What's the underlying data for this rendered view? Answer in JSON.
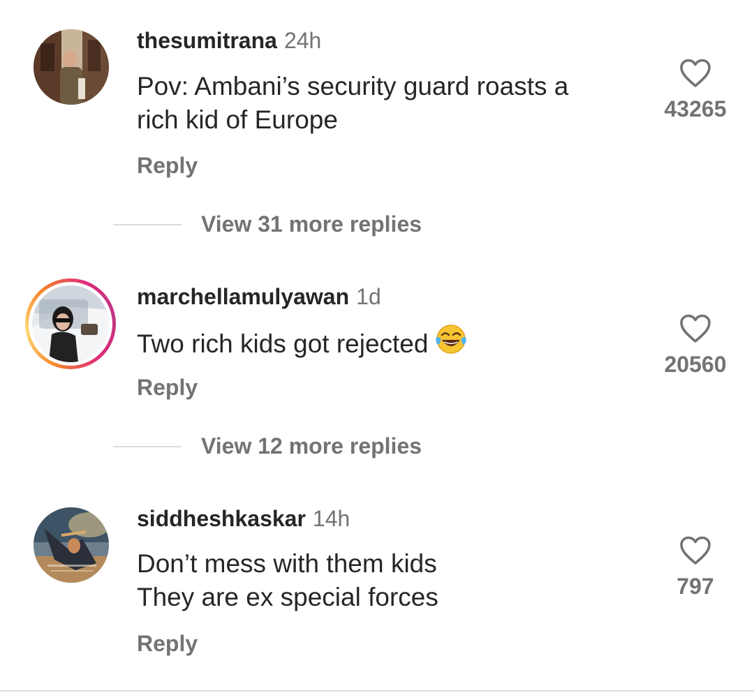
{
  "comments": [
    {
      "username": "thesumitrana",
      "time": "24h",
      "lines": [
        "Pov: Ambani’s security guard roasts a",
        "rich kid of Europe"
      ],
      "reply_label": "Reply",
      "likes": "43265",
      "view_replies": "View 31 more replies",
      "avatar_icon": "avatar-photo-man-walking"
    },
    {
      "username": "marchellamulyawan",
      "time": "1d",
      "lines": [
        "Two rich kids got rejected"
      ],
      "emoji": "tears-of-joy-emoji",
      "reply_label": "Reply",
      "likes": "20560",
      "view_replies": "View 12 more replies",
      "avatar_icon": "avatar-photo-woman-in-car",
      "has_story": true
    },
    {
      "username": "siddheshkaskar",
      "time": "14h",
      "lines": [
        "Don’t mess with them kids",
        "They are ex special forces"
      ],
      "reply_label": "Reply",
      "likes": "797",
      "avatar_icon": "avatar-photo-warrior-art"
    }
  ],
  "colors": {
    "primary_text": "#262626",
    "secondary_text": "#737373",
    "divider": "#dbdbdb",
    "background": "#ffffff"
  },
  "icons": {
    "like": "heart-outline-icon"
  }
}
